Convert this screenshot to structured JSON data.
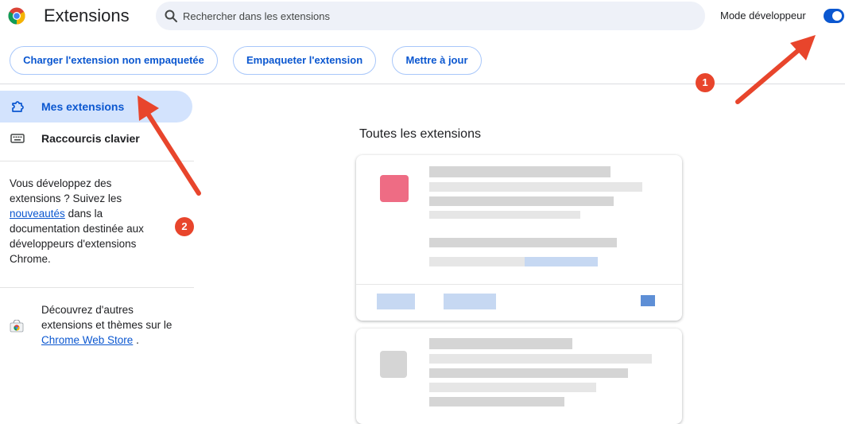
{
  "header": {
    "title": "Extensions",
    "search_placeholder": "Rechercher dans les extensions",
    "dev_mode_label": "Mode développeur",
    "dev_mode_on": true
  },
  "toolbar": {
    "load_unpacked": "Charger l'extension non empaquetée",
    "pack_extension": "Empaqueter l'extension",
    "update": "Mettre à jour"
  },
  "sidebar": {
    "items": [
      {
        "label": "Mes extensions",
        "icon": "puzzle-icon",
        "active": true
      },
      {
        "label": "Raccourcis clavier",
        "icon": "keyboard-icon",
        "active": false
      }
    ],
    "dev_info": {
      "before": "Vous développez des extensions ? Suivez les",
      "link": "nouveautés",
      "after": "dans la documentation destinée aux développeurs d'extensions Chrome."
    },
    "store_info": {
      "before": "Découvrez d'autres extensions et thèmes sur le",
      "link": "Chrome Web Store",
      "after": "."
    }
  },
  "main": {
    "section_title": "Toutes les extensions"
  },
  "annotations": {
    "badge_1": "1",
    "badge_2": "2",
    "arrow_color": "#e8452c"
  },
  "colors": {
    "accent": "#0b57d0",
    "active_nav_bg": "#d3e3fd",
    "search_bg": "#eef1f8"
  }
}
